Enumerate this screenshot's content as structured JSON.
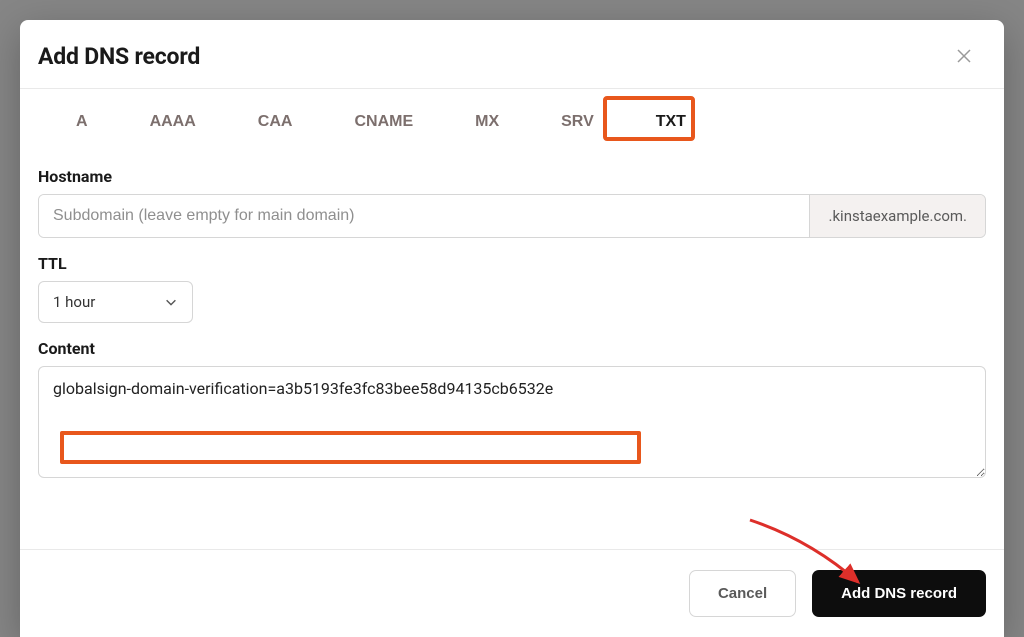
{
  "modal": {
    "title": "Add DNS record"
  },
  "tabs": [
    {
      "label": "A",
      "active": false
    },
    {
      "label": "AAAA",
      "active": false
    },
    {
      "label": "CAA",
      "active": false
    },
    {
      "label": "CNAME",
      "active": false
    },
    {
      "label": "MX",
      "active": false
    },
    {
      "label": "SRV",
      "active": false
    },
    {
      "label": "TXT",
      "active": true
    }
  ],
  "fields": {
    "hostname": {
      "label": "Hostname",
      "placeholder": "Subdomain (leave empty for main domain)",
      "value": "",
      "suffix": ".kinstaexample.com."
    },
    "ttl": {
      "label": "TTL",
      "value": "1 hour"
    },
    "content": {
      "label": "Content",
      "value": "globalsign-domain-verification=a3b5193fe3fc83bee58d94135cb6532e"
    }
  },
  "footer": {
    "cancel": "Cancel",
    "submit": "Add DNS record"
  },
  "annotations": {
    "highlight_color": "#e8571c",
    "arrow_color": "#dd2f2a"
  }
}
